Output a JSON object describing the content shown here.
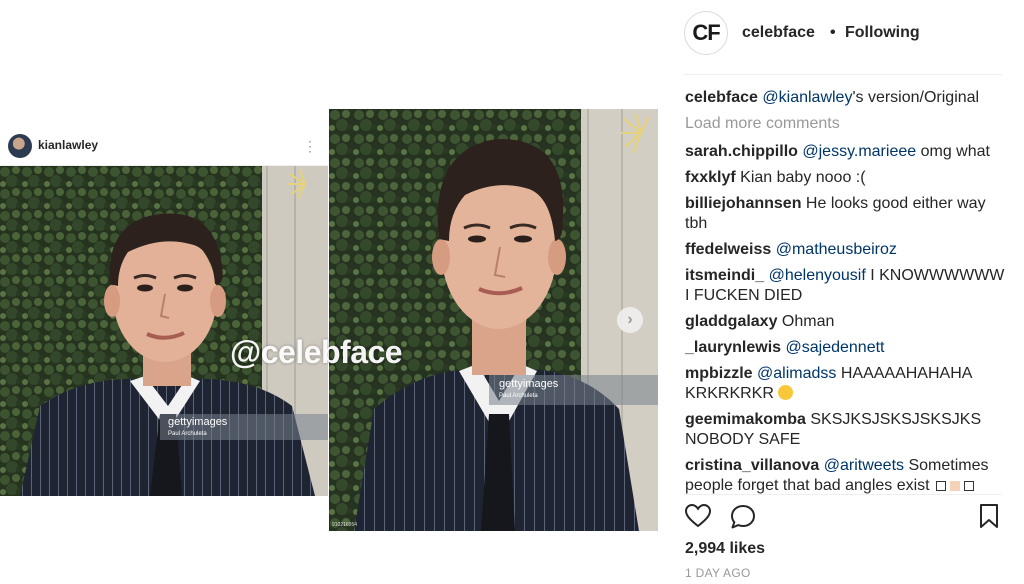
{
  "inner_post": {
    "username": "kianlawley",
    "more_icon": "more-vertical-icon"
  },
  "media": {
    "watermark": "@celebface",
    "getty_left": {
      "brand": "gettyimages",
      "credit": "Paul Archuleta"
    },
    "getty_right": {
      "brand": "gettyimages",
      "credit": "Paul Archuleta"
    },
    "photo_id": "910216954",
    "next_icon": "chevron-right-icon"
  },
  "header": {
    "avatar_text": "CF",
    "username": "celebface",
    "separator": "•",
    "follow_status": "Following"
  },
  "caption": {
    "user": "celebface",
    "mention": "@kianlawley",
    "text": "'s version/Original"
  },
  "load_more": "Load more comments",
  "comments": [
    {
      "user": "sarah.chippillo",
      "mention": "@jessy.marieee",
      "text": " omg what"
    },
    {
      "user": "fxxklyf",
      "mention": "",
      "text": " Kian baby nooo :("
    },
    {
      "user": "billiejohannsen",
      "mention": "",
      "text": " He looks good either way tbh"
    },
    {
      "user": "ffedelweiss",
      "mention": "@matheusbeiroz",
      "text": ""
    },
    {
      "user": "itsmeindi_",
      "mention": "@helenyousif",
      "text": " I KNOWWWWWW I FUCKEN DIED"
    },
    {
      "user": "gladdgalaxy",
      "mention": "",
      "text": " Ohman"
    },
    {
      "user": "_laurynlewis",
      "mention": "@sajedennett",
      "text": ""
    },
    {
      "user": "mpbizzle",
      "mention": "@alimadss",
      "text": " HAAAAAHAHAHA KRKRKRKR"
    },
    {
      "user": "geemimakomba",
      "mention": "",
      "text": " SKSJKSJSKSJSKSJKS NOBODY SAFE"
    },
    {
      "user": "cristina_villanova",
      "mention": "@aritweets",
      "text": " Sometimes people forget that bad angles exist"
    }
  ],
  "actions": {
    "like_icon": "heart-icon",
    "comment_icon": "comment-bubble-icon",
    "save_icon": "bookmark-icon"
  },
  "likes": "2,994 likes",
  "timestamp": "1 DAY AGO"
}
